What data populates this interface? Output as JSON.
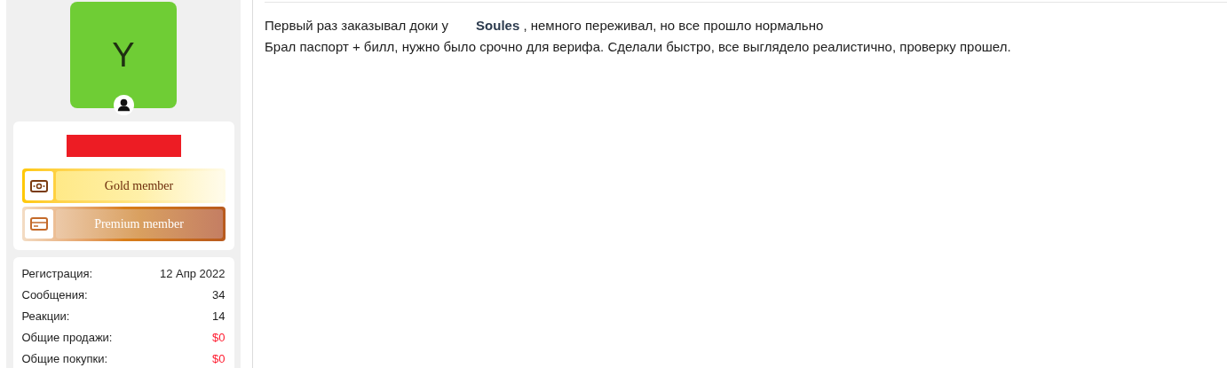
{
  "avatar": {
    "letter": "Y"
  },
  "badges": [
    {
      "kind": "gold",
      "label": "Gold member"
    },
    {
      "kind": "premium",
      "label": "Premium member"
    }
  ],
  "stats": [
    {
      "label": "Регистрация:",
      "value": "12 Апр 2022",
      "kind": "plain"
    },
    {
      "label": "Сообщения:",
      "value": "34",
      "kind": "plain"
    },
    {
      "label": "Реакции:",
      "value": "14",
      "kind": "plain"
    },
    {
      "label": "Общие продажи:",
      "value": "$0",
      "kind": "money"
    },
    {
      "label": "Общие покупки:",
      "value": "$0",
      "kind": "money"
    }
  ],
  "post": {
    "line_1": {
      "before": "Первый раз заказывал доки у",
      "mention": "Soules",
      "after": ", немного переживал, но все прошло нормально"
    },
    "line_2": "Брал паспорт + билл, нужно было срочно для верифа. Сделали быстро, все выглядело реалистично, проверку прошел."
  }
}
